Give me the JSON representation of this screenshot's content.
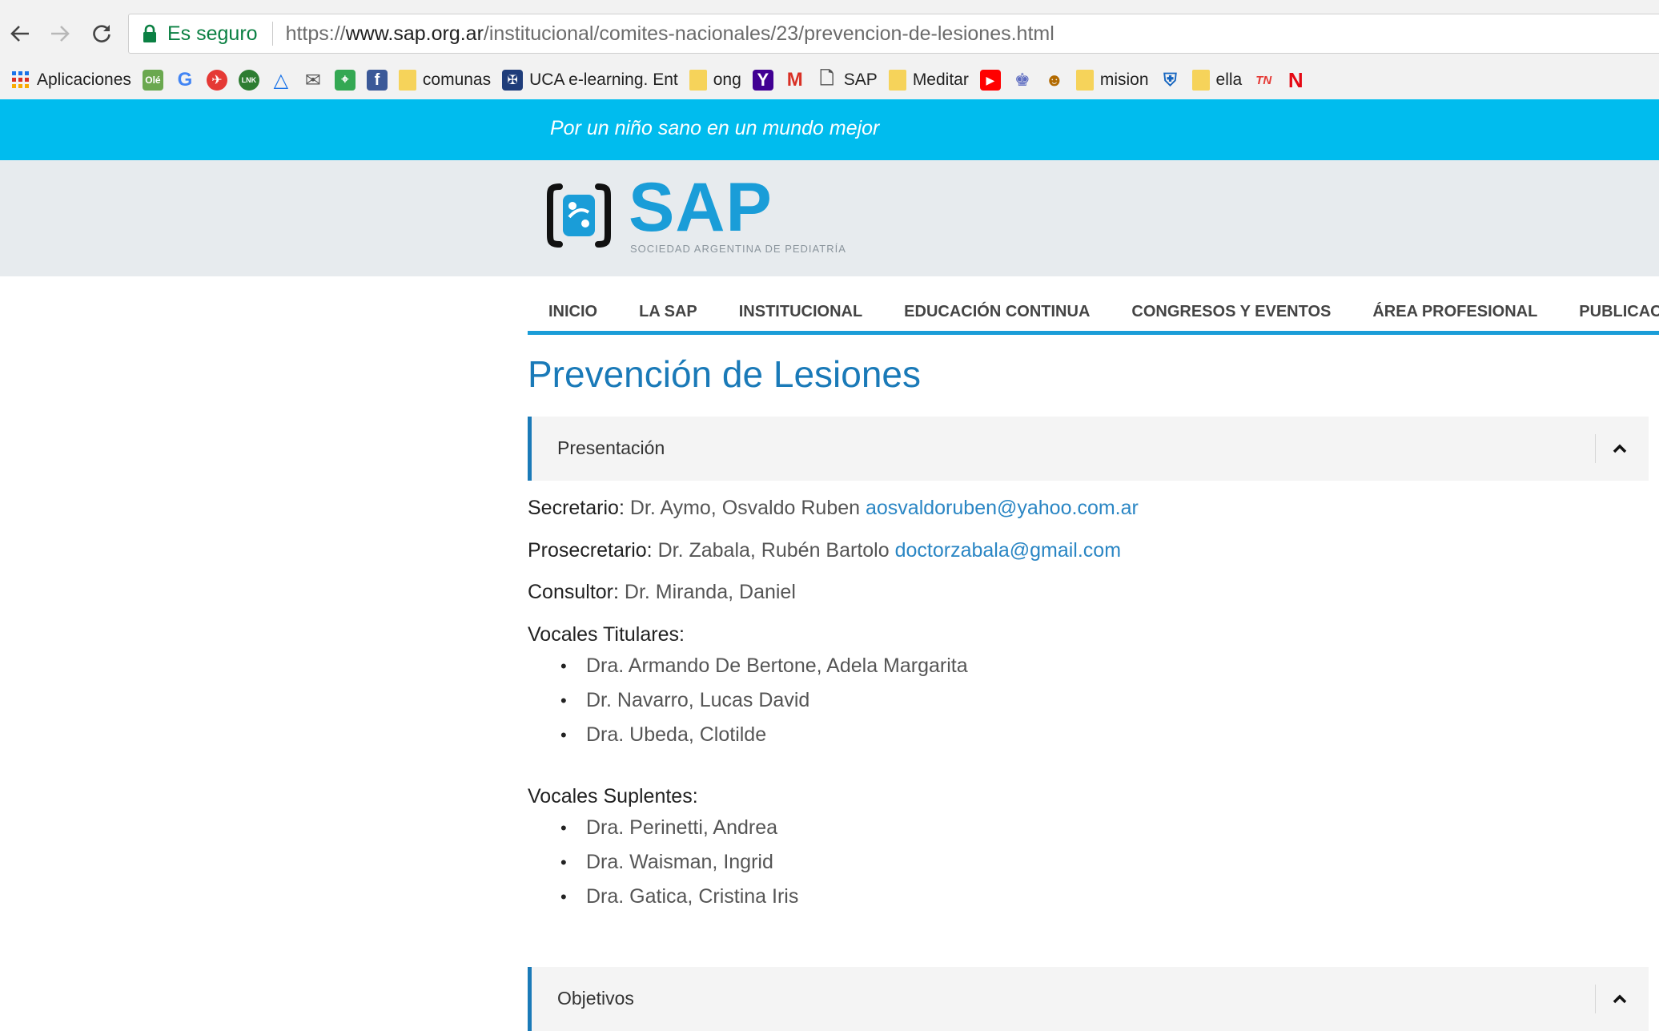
{
  "browser": {
    "secure_label": "Es seguro",
    "url_scheme": "https://",
    "url_host": "www.sap.org.ar",
    "url_path": "/institucional/comites-nacionales/23/prevencion-de-lesiones.html",
    "bookmarks": {
      "apps": "Aplicaciones",
      "ole": "Olé",
      "comunas": "comunas",
      "uca": "UCA e-learning. Ent",
      "ong": "ong",
      "sap": "SAP",
      "meditar": "Meditar",
      "mision": "mision",
      "ella": "ella"
    }
  },
  "site": {
    "tagline": "Por un niño sano en un mundo mejor",
    "logo_text": "SAP",
    "logo_subtitle": "SOCIEDAD ARGENTINA DE PEDIATRÍA",
    "nav": [
      "INICIO",
      "LA SAP",
      "INSTITUCIONAL",
      "EDUCACIÓN CONTINUA",
      "CONGRESOS Y EVENTOS",
      "ÁREA PROFESIONAL",
      "PUBLICACIO"
    ]
  },
  "page": {
    "title": "Prevención de Lesiones",
    "sections": [
      {
        "title": "Presentación",
        "expanded": true
      },
      {
        "title": "Objetivos",
        "expanded": true
      }
    ],
    "secretario": {
      "label": "Secretario:",
      "name": "Dr. Aymo, Osvaldo Ruben",
      "email": "aosvaldoruben@yahoo.com.ar"
    },
    "prosecretario": {
      "label": "Prosecretario:",
      "name": "Dr. Zabala, Rubén Bartolo",
      "email": "doctorzabala@gmail.com"
    },
    "consultor": {
      "label": "Consultor:",
      "name": "Dr. Miranda, Daniel"
    },
    "vocales_titulares": {
      "label": "Vocales Titulares:",
      "members": [
        "Dra. Armando De Bertone, Adela Margarita",
        "Dr. Navarro, Lucas David",
        "Dra. Ubeda, Clotilde"
      ]
    },
    "vocales_suplentes": {
      "label": "Vocales Suplentes:",
      "members": [
        "Dra. Perinetti,  Andrea",
        "Dra. Waisman, Ingrid",
        "Dra. Gatica, Cristina Iris"
      ]
    }
  },
  "colors": {
    "tagline_bar": "#00bcee",
    "brand_blue": "#1a9dd8",
    "title_blue": "#1a7ab8",
    "link": "#2a86c4"
  }
}
